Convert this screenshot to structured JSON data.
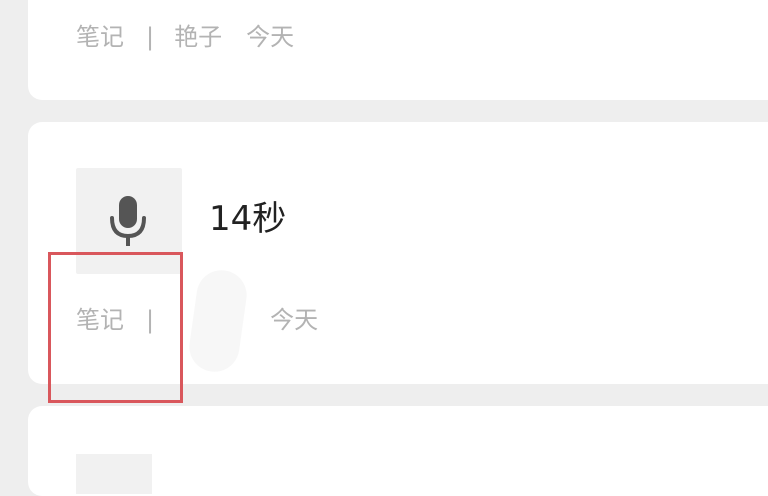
{
  "cards": [
    {
      "type": "note",
      "category": "笔记",
      "separator": "|",
      "author": "艳子",
      "date": "今天"
    },
    {
      "type": "voice",
      "duration": "14秒",
      "category": "笔记",
      "separator": "|",
      "author": "",
      "date": "今天",
      "icon": "microphone-icon"
    },
    {
      "type": "note",
      "icon": ""
    }
  ],
  "colors": {
    "background": "#eeeeee",
    "card": "#ffffff",
    "meta_text": "#b3b3b3",
    "title_text": "#222222",
    "highlight": "#d9575c"
  }
}
